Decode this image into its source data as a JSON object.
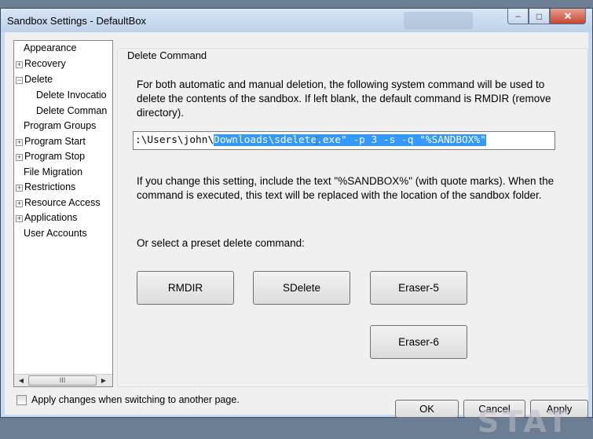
{
  "window": {
    "title": "Sandbox Settings - DefaultBox",
    "controls": {
      "minimize": "–",
      "maximize": "□",
      "close": "✕"
    }
  },
  "tree": {
    "items": [
      {
        "label": "Appearance",
        "expander": ""
      },
      {
        "label": "Recovery",
        "expander": "+"
      },
      {
        "label": "Delete",
        "expander": "−"
      },
      {
        "label": "Delete Invocatio",
        "expander": ""
      },
      {
        "label": "Delete Comman",
        "expander": ""
      },
      {
        "label": "Program Groups",
        "expander": ""
      },
      {
        "label": "Program Start",
        "expander": "+"
      },
      {
        "label": "Program Stop",
        "expander": "+"
      },
      {
        "label": "File Migration",
        "expander": ""
      },
      {
        "label": "Restrictions",
        "expander": "+"
      },
      {
        "label": "Resource Access",
        "expander": "+"
      },
      {
        "label": "Applications",
        "expander": "+"
      },
      {
        "label": "User Accounts",
        "expander": ""
      }
    ],
    "scroll": {
      "left": "◀",
      "right": "▶",
      "thumb": "III"
    }
  },
  "panel": {
    "group_title": "Delete Command",
    "description": [
      "For both automatic and manual deletion, the following system command will be used to",
      "delete the contents of the sandbox.  If left blank, the default command is RMDIR (remove",
      "directory)."
    ],
    "command": {
      "prefix": ":\\Users\\john\\",
      "selected": "Downloads\\sdelete.exe\" -p 3 -s -q \"%SANDBOX%\""
    },
    "note": [
      "If you change this setting, include the text \"%SANDBOX%\" (with quote marks).  When the",
      "command is executed, this text will be replaced with the location of the sandbox folder."
    ],
    "preset_label": "Or select a preset delete command:",
    "presets": [
      "RMDIR",
      "SDelete",
      "Eraser-5",
      "Eraser-6"
    ]
  },
  "footer": {
    "apply_on_switch": "Apply changes when switching to another page.",
    "ok": "OK",
    "cancel": "Cancel",
    "apply": "Apply",
    "watermark": "STAT"
  }
}
